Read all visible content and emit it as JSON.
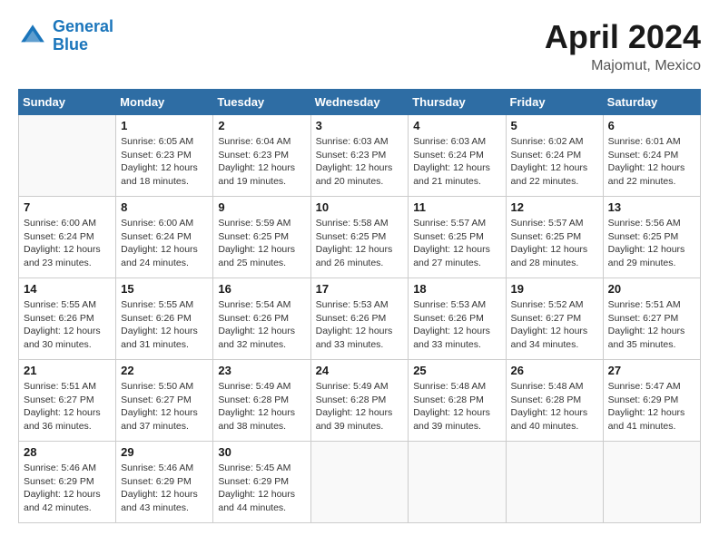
{
  "header": {
    "logo_line1": "General",
    "logo_line2": "Blue",
    "month": "April 2024",
    "location": "Majomut, Mexico"
  },
  "weekdays": [
    "Sunday",
    "Monday",
    "Tuesday",
    "Wednesday",
    "Thursday",
    "Friday",
    "Saturday"
  ],
  "weeks": [
    [
      {
        "day": "",
        "info": ""
      },
      {
        "day": "1",
        "info": "Sunrise: 6:05 AM\nSunset: 6:23 PM\nDaylight: 12 hours\nand 18 minutes."
      },
      {
        "day": "2",
        "info": "Sunrise: 6:04 AM\nSunset: 6:23 PM\nDaylight: 12 hours\nand 19 minutes."
      },
      {
        "day": "3",
        "info": "Sunrise: 6:03 AM\nSunset: 6:23 PM\nDaylight: 12 hours\nand 20 minutes."
      },
      {
        "day": "4",
        "info": "Sunrise: 6:03 AM\nSunset: 6:24 PM\nDaylight: 12 hours\nand 21 minutes."
      },
      {
        "day": "5",
        "info": "Sunrise: 6:02 AM\nSunset: 6:24 PM\nDaylight: 12 hours\nand 22 minutes."
      },
      {
        "day": "6",
        "info": "Sunrise: 6:01 AM\nSunset: 6:24 PM\nDaylight: 12 hours\nand 22 minutes."
      }
    ],
    [
      {
        "day": "7",
        "info": "Sunrise: 6:00 AM\nSunset: 6:24 PM\nDaylight: 12 hours\nand 23 minutes."
      },
      {
        "day": "8",
        "info": "Sunrise: 6:00 AM\nSunset: 6:24 PM\nDaylight: 12 hours\nand 24 minutes."
      },
      {
        "day": "9",
        "info": "Sunrise: 5:59 AM\nSunset: 6:25 PM\nDaylight: 12 hours\nand 25 minutes."
      },
      {
        "day": "10",
        "info": "Sunrise: 5:58 AM\nSunset: 6:25 PM\nDaylight: 12 hours\nand 26 minutes."
      },
      {
        "day": "11",
        "info": "Sunrise: 5:57 AM\nSunset: 6:25 PM\nDaylight: 12 hours\nand 27 minutes."
      },
      {
        "day": "12",
        "info": "Sunrise: 5:57 AM\nSunset: 6:25 PM\nDaylight: 12 hours\nand 28 minutes."
      },
      {
        "day": "13",
        "info": "Sunrise: 5:56 AM\nSunset: 6:25 PM\nDaylight: 12 hours\nand 29 minutes."
      }
    ],
    [
      {
        "day": "14",
        "info": "Sunrise: 5:55 AM\nSunset: 6:26 PM\nDaylight: 12 hours\nand 30 minutes."
      },
      {
        "day": "15",
        "info": "Sunrise: 5:55 AM\nSunset: 6:26 PM\nDaylight: 12 hours\nand 31 minutes."
      },
      {
        "day": "16",
        "info": "Sunrise: 5:54 AM\nSunset: 6:26 PM\nDaylight: 12 hours\nand 32 minutes."
      },
      {
        "day": "17",
        "info": "Sunrise: 5:53 AM\nSunset: 6:26 PM\nDaylight: 12 hours\nand 33 minutes."
      },
      {
        "day": "18",
        "info": "Sunrise: 5:53 AM\nSunset: 6:26 PM\nDaylight: 12 hours\nand 33 minutes."
      },
      {
        "day": "19",
        "info": "Sunrise: 5:52 AM\nSunset: 6:27 PM\nDaylight: 12 hours\nand 34 minutes."
      },
      {
        "day": "20",
        "info": "Sunrise: 5:51 AM\nSunset: 6:27 PM\nDaylight: 12 hours\nand 35 minutes."
      }
    ],
    [
      {
        "day": "21",
        "info": "Sunrise: 5:51 AM\nSunset: 6:27 PM\nDaylight: 12 hours\nand 36 minutes."
      },
      {
        "day": "22",
        "info": "Sunrise: 5:50 AM\nSunset: 6:27 PM\nDaylight: 12 hours\nand 37 minutes."
      },
      {
        "day": "23",
        "info": "Sunrise: 5:49 AM\nSunset: 6:28 PM\nDaylight: 12 hours\nand 38 minutes."
      },
      {
        "day": "24",
        "info": "Sunrise: 5:49 AM\nSunset: 6:28 PM\nDaylight: 12 hours\nand 39 minutes."
      },
      {
        "day": "25",
        "info": "Sunrise: 5:48 AM\nSunset: 6:28 PM\nDaylight: 12 hours\nand 39 minutes."
      },
      {
        "day": "26",
        "info": "Sunrise: 5:48 AM\nSunset: 6:28 PM\nDaylight: 12 hours\nand 40 minutes."
      },
      {
        "day": "27",
        "info": "Sunrise: 5:47 AM\nSunset: 6:29 PM\nDaylight: 12 hours\nand 41 minutes."
      }
    ],
    [
      {
        "day": "28",
        "info": "Sunrise: 5:46 AM\nSunset: 6:29 PM\nDaylight: 12 hours\nand 42 minutes."
      },
      {
        "day": "29",
        "info": "Sunrise: 5:46 AM\nSunset: 6:29 PM\nDaylight: 12 hours\nand 43 minutes."
      },
      {
        "day": "30",
        "info": "Sunrise: 5:45 AM\nSunset: 6:29 PM\nDaylight: 12 hours\nand 44 minutes."
      },
      {
        "day": "",
        "info": ""
      },
      {
        "day": "",
        "info": ""
      },
      {
        "day": "",
        "info": ""
      },
      {
        "day": "",
        "info": ""
      }
    ]
  ]
}
